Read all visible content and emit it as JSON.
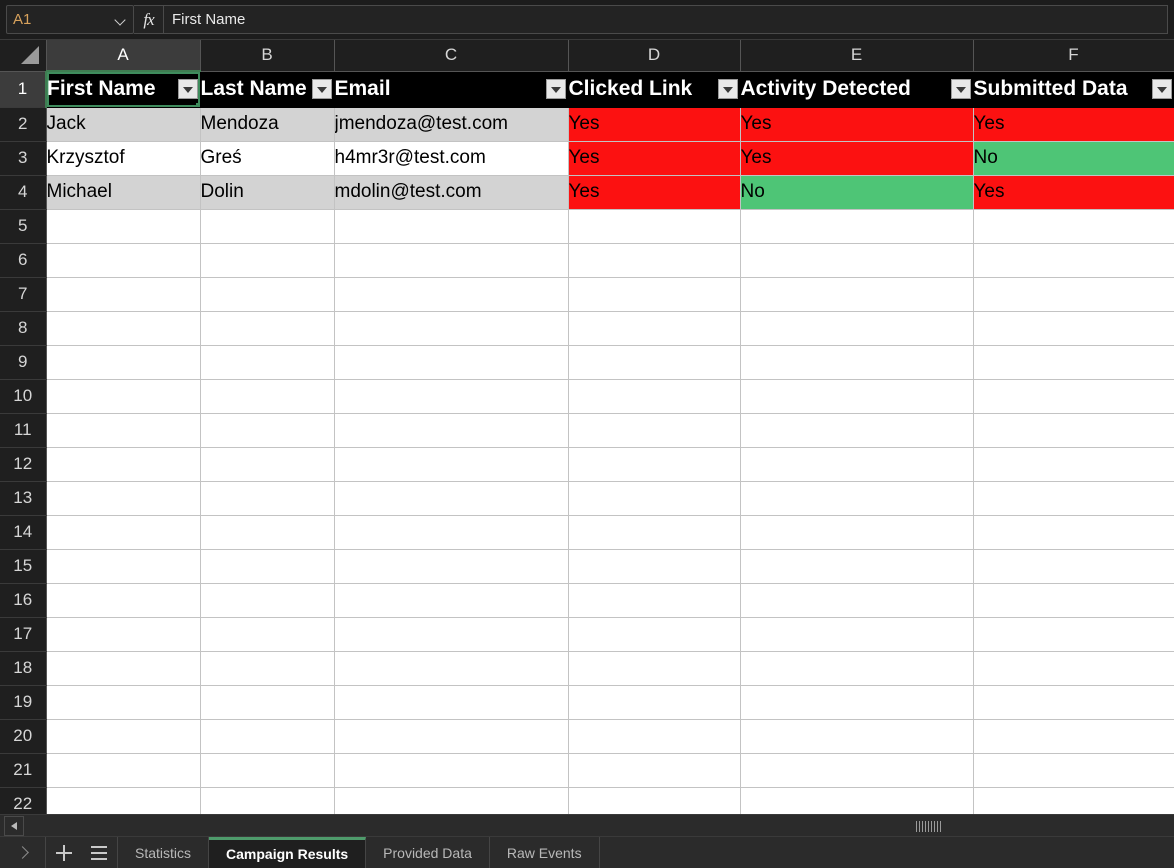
{
  "formula_bar": {
    "name_box_value": "A1",
    "name_box_chevron_icon": "chevron-down-icon",
    "fx_label": "fx",
    "formula_value": "First Name"
  },
  "grid": {
    "corner_icon": "select-all-triangle-icon",
    "column_headers": [
      "A",
      "B",
      "C",
      "D",
      "E",
      "F"
    ],
    "active_column": "A",
    "active_row": "1",
    "row_numbers": [
      "1",
      "2",
      "3",
      "4",
      "5",
      "6",
      "7",
      "8",
      "9",
      "10",
      "11",
      "12",
      "13",
      "14",
      "15",
      "16",
      "17",
      "18",
      "19",
      "20",
      "21",
      "22"
    ],
    "filter_icon": "filter-dropdown-icon",
    "table_headers": [
      "First Name",
      "Last Name",
      "Email",
      "Clicked Link",
      "Activity Detected",
      "Submitted Data"
    ],
    "rows": [
      {
        "first_name": "Jack",
        "last_name": "Mendoza",
        "email": "jmendoza@test.com",
        "clicked_link": "Yes",
        "activity_detected": "Yes",
        "submitted_data": "Yes"
      },
      {
        "first_name": "Krzysztof",
        "last_name": "Greś",
        "email": "h4mr3r@test.com",
        "clicked_link": "Yes",
        "activity_detected": "Yes",
        "submitted_data": "No"
      },
      {
        "first_name": "Michael",
        "last_name": "Dolin",
        "email": "mdolin@test.com",
        "clicked_link": "Yes",
        "activity_detected": "No",
        "submitted_data": "Yes"
      }
    ],
    "selected_cell": "A1",
    "selected_cell_value": "First Name"
  },
  "colors": {
    "yes_fill": "#fc1111",
    "no_fill": "#4ec576",
    "header_fill": "#000000",
    "band_fill": "#d3d3d3",
    "selection_border": "#3f8c5d",
    "active_tab_accent": "#4e9b6b",
    "name_box_text": "#d8a25c",
    "fill_handle_blue": "#4a5ecb"
  },
  "scrollbar": {
    "left_arrow_icon": "scroll-left-arrow-icon",
    "grip_icon": "scroll-grip-icon"
  },
  "tabbar": {
    "nav_icon": "chevron-right-icon",
    "add_sheet_icon": "plus-icon",
    "sheet_list_icon": "list-menu-icon",
    "tabs": [
      {
        "label": "Statistics",
        "active": false
      },
      {
        "label": "Campaign Results",
        "active": true
      },
      {
        "label": "Provided Data",
        "active": false
      },
      {
        "label": "Raw Events",
        "active": false
      }
    ]
  }
}
